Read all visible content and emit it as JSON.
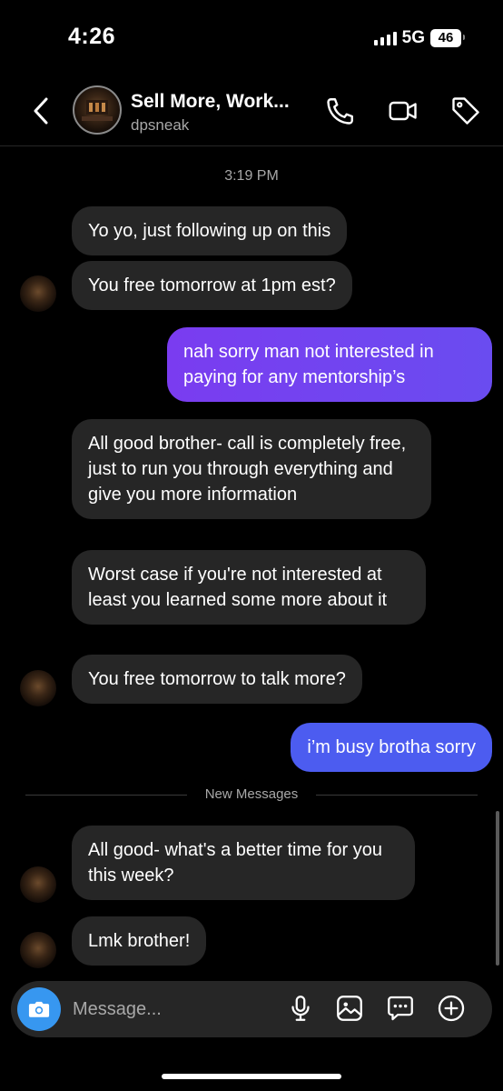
{
  "status_bar": {
    "time": "4:26",
    "network": "5G",
    "battery": "46"
  },
  "header": {
    "title": "Sell More, Work...",
    "username": "dpsneak",
    "icons": [
      "back-chevron-icon",
      "phone-icon",
      "video-camera-icon",
      "tag-icon"
    ]
  },
  "conversation": {
    "timestamp": "3:19 PM",
    "messages": [
      {
        "side": "incoming",
        "text": "Yo yo, just following up on this"
      },
      {
        "side": "incoming",
        "text": "You free tomorrow at 1pm est?"
      },
      {
        "side": "outgoing",
        "text": "nah sorry man not interested in paying for any mentorship’s"
      },
      {
        "side": "incoming",
        "text": "All good brother- call is completely free, just to run you through everything and give you more information"
      },
      {
        "side": "incoming",
        "text": "Worst case if you're not interested at least you learned some more about it"
      },
      {
        "side": "incoming",
        "text": "You free tomorrow to talk more?"
      },
      {
        "side": "outgoing",
        "text": "i’m busy brotha sorry"
      },
      {
        "side": "incoming",
        "text": "All good- what's a better time for you this week?"
      },
      {
        "side": "incoming",
        "text": "Lmk brother!"
      }
    ],
    "new_messages_label": "New Messages"
  },
  "composer": {
    "placeholder": "Message...",
    "icons": [
      "camera-icon",
      "microphone-icon",
      "gallery-icon",
      "sticker-icon",
      "add-icon"
    ]
  },
  "colors": {
    "background": "#000000",
    "incoming_bubble": "#262626",
    "outgoing_gradient": [
      "#7a3cf0",
      "#4a5cf0"
    ],
    "camera_button": "#3797f0"
  }
}
